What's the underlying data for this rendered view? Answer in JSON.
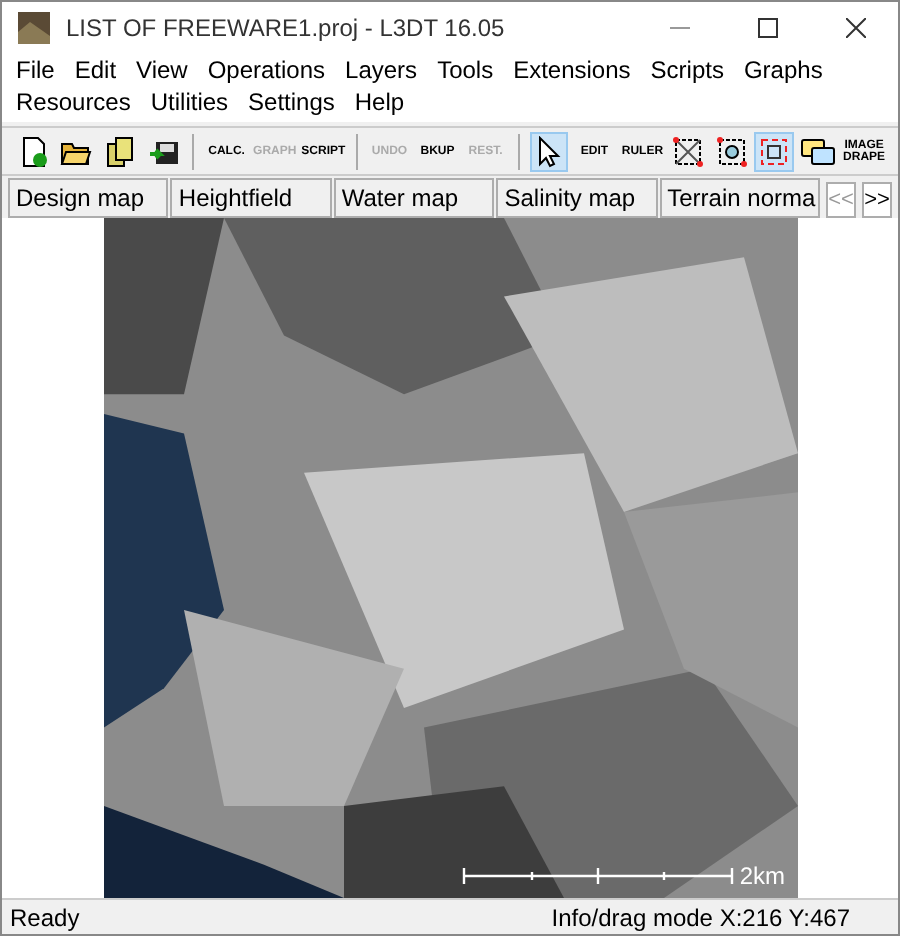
{
  "window": {
    "title": "LIST OF FREEWARE1.proj - L3DT 16.05"
  },
  "menu": [
    "File",
    "Edit",
    "View",
    "Operations",
    "Layers",
    "Tools",
    "Extensions",
    "Scripts",
    "Graphs",
    "Resources",
    "Utilities",
    "Settings",
    "Help"
  ],
  "toolbar": [
    {
      "kind": "new",
      "selected": false,
      "disabled": false
    },
    {
      "kind": "open",
      "selected": false,
      "disabled": false
    },
    {
      "kind": "copy",
      "selected": false,
      "disabled": false
    },
    {
      "kind": "save",
      "selected": false,
      "disabled": false
    },
    {
      "kind": "separator"
    },
    {
      "kind": "text",
      "label": "CALC.",
      "selected": false,
      "disabled": false
    },
    {
      "kind": "text",
      "label": "GRAPH",
      "selected": false,
      "disabled": true
    },
    {
      "kind": "text",
      "label": "SCRIPT",
      "selected": false,
      "disabled": false
    },
    {
      "kind": "separator"
    },
    {
      "kind": "text",
      "label": "UNDO",
      "selected": false,
      "disabled": true
    },
    {
      "kind": "text",
      "label": "BKUP",
      "selected": false,
      "disabled": false
    },
    {
      "kind": "text",
      "label": "REST.",
      "selected": false,
      "disabled": true
    },
    {
      "kind": "separator"
    },
    {
      "kind": "pointer",
      "selected": true,
      "disabled": false
    },
    {
      "kind": "text",
      "label": "EDIT",
      "selected": false,
      "disabled": false
    },
    {
      "kind": "text",
      "label": "RULER",
      "selected": false,
      "disabled": false
    },
    {
      "kind": "select",
      "selected": false,
      "disabled": false
    },
    {
      "kind": "zoom-select",
      "selected": false,
      "disabled": false
    },
    {
      "kind": "frame",
      "selected": true,
      "disabled": false
    },
    {
      "kind": "chat",
      "selected": false,
      "disabled": false
    },
    {
      "kind": "text",
      "label": "IMAGE DRAPE",
      "selected": false,
      "disabled": false
    }
  ],
  "tabs": [
    {
      "label": "Design map",
      "selected": false
    },
    {
      "label": "Heightfield",
      "selected": false
    },
    {
      "label": "Water map",
      "selected": false
    },
    {
      "label": "Salinity map",
      "selected": false
    },
    {
      "label": "Terrain norma",
      "selected": false
    }
  ],
  "tab_scroll": [
    "<<",
    ">>"
  ],
  "map": {
    "kind": "picture",
    "scale_label": "2km"
  },
  "status_bar": {
    "left": "Ready",
    "right": "Info/drag mode X:216 Y:467"
  }
}
